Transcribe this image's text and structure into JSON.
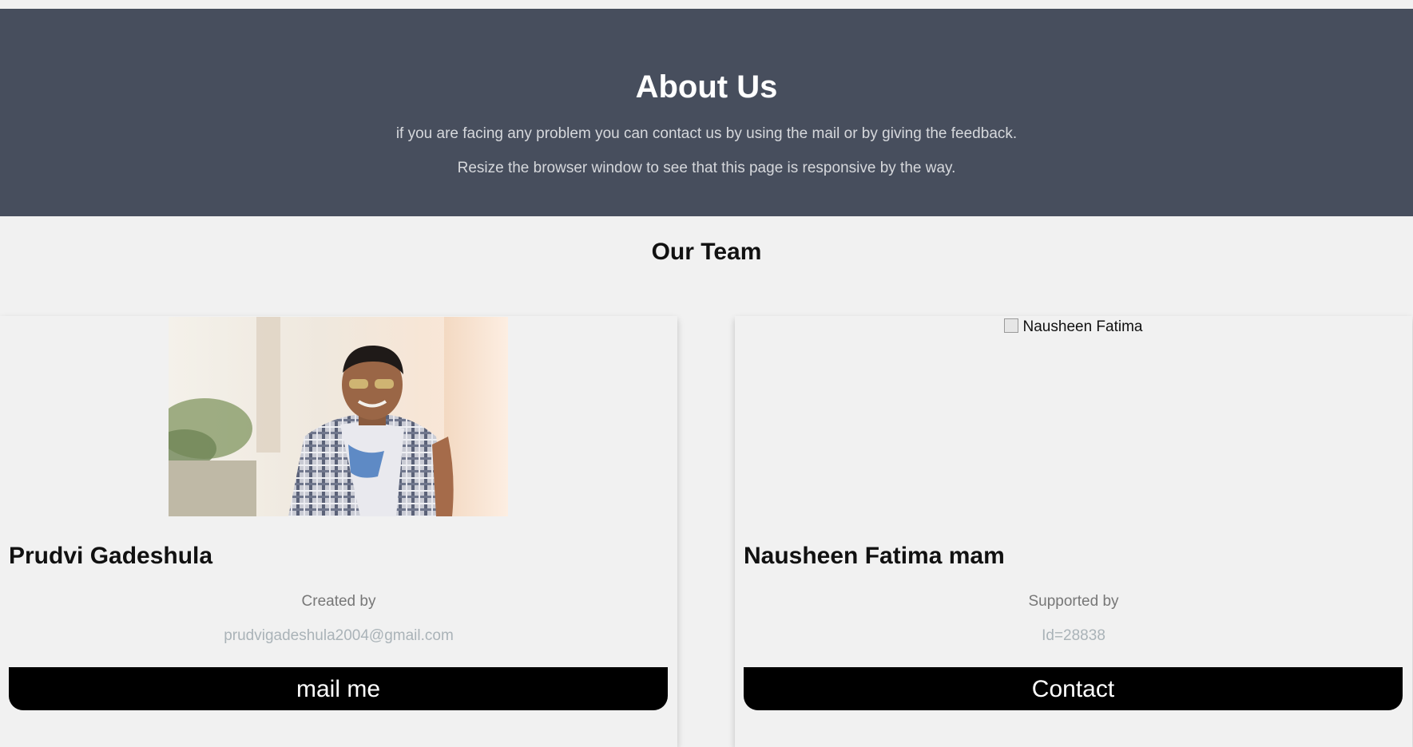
{
  "about": {
    "title": "About Us",
    "line1": "if you are facing any problem you can contact us by using the mail or by giving the feedback.",
    "line2": "Resize the browser window to see that this page is responsive by the way."
  },
  "team": {
    "heading": "Our Team",
    "members": [
      {
        "name": "Prudvi Gadeshula",
        "role": "Created by",
        "contact": "prudvigadeshula2004@gmail.com",
        "button": "mail me"
      },
      {
        "name": "Nausheen Fatima mam",
        "image_alt": "Nausheen Fatima",
        "role": "Supported by",
        "contact": "Id=28838",
        "button": "Contact"
      }
    ]
  },
  "colors": {
    "header_bg": "#474e5d",
    "page_bg": "#f1f1f1",
    "button_bg": "#000000"
  }
}
